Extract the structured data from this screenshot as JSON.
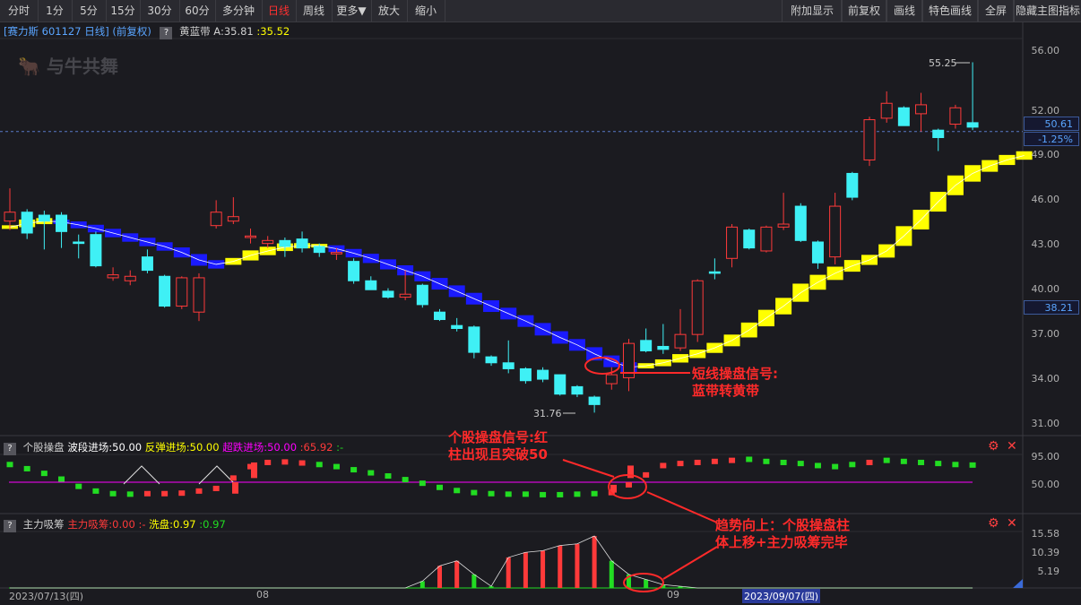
{
  "toolbar": {
    "left": [
      "分时",
      "1分",
      "5分",
      "15分",
      "30分",
      "60分",
      "多分钟",
      "日线",
      "周线",
      "更多▼",
      "放大",
      "缩小"
    ],
    "active": "日线",
    "right": [
      "附加显示",
      "前复权",
      "画线",
      "特色画线",
      "全屏",
      "隐藏主图指标"
    ]
  },
  "main": {
    "stock_label": "[赛力斯 601127 日线] (前复权)",
    "indicator_name": "黄蓝带",
    "indicator_a": "A:35.81",
    "indicator_b": ":35.52",
    "watermark": "与牛共舞",
    "price_now": "50.61",
    "change": "-1.25%",
    "cross_price": "38.21",
    "high_label": "55.25",
    "low_label": "31.76",
    "yticks": [
      "56.00",
      "52.00",
      "49.00",
      "46.00",
      "43.00",
      "40.00",
      "37.00",
      "34.00",
      "31.00"
    ]
  },
  "sub1": {
    "name": "个股操盘",
    "l1": "波段进场:50.00",
    "l2": "反弹进场:50.00",
    "l3": "超跌进场:50.00",
    "l4": ":65.92",
    "l5": ":-",
    "yticks": [
      "95.00",
      "50.00"
    ]
  },
  "sub2": {
    "name": "主力吸筹",
    "l1": "主力吸筹:0.00",
    "l2": ":-",
    "l3": "洗盘:0.97",
    "l4": ":0.97",
    "yticks": [
      "15.58",
      "10.39",
      "5.19"
    ]
  },
  "xaxis": {
    "start": "2023/07/13(四)",
    "aug": "08",
    "sep": "09",
    "cursor_date": "2023/09/07(四)"
  },
  "annotations": {
    "a1_line1": "短线操盘信号:",
    "a1_line2": "蓝带转黄带",
    "a2_line1": "个股操盘信号:红",
    "a2_line2": "柱出现且突破50",
    "a3_line1": "趋势向上：个股操盘柱",
    "a3_line2": "体上移+主力吸筹完毕"
  },
  "colors": {
    "up": "#ff3a3a",
    "down": "#3ff0f5",
    "yellow": "#ffff00",
    "blue": "#1a1aff",
    "green": "#22dd22",
    "magenta": "#ff00ff"
  },
  "candles": [
    [
      44.6,
      45.2,
      44.0,
      46.8
    ],
    [
      45.2,
      43.8,
      43.4,
      45.4
    ],
    [
      45.0,
      44.6,
      42.7,
      45.3
    ],
    [
      45.0,
      43.9,
      42.8,
      45.2
    ],
    [
      43.2,
      43.1,
      42.1,
      43.7
    ],
    [
      43.7,
      41.6,
      41.5,
      43.9
    ],
    [
      40.8,
      41.0,
      40.6,
      41.5
    ],
    [
      40.6,
      40.9,
      40.3,
      41.3
    ],
    [
      42.2,
      41.3,
      41.1,
      42.7
    ],
    [
      40.9,
      38.9,
      38.8,
      41.0
    ],
    [
      38.9,
      40.8,
      38.7,
      40.9
    ],
    [
      38.5,
      40.8,
      37.9,
      41.1
    ],
    [
      44.3,
      45.2,
      44.1,
      46.0
    ],
    [
      44.6,
      44.9,
      44.4,
      46.2
    ],
    [
      43.5,
      43.6,
      43.1,
      44.1
    ],
    [
      43.1,
      43.3,
      42.8,
      43.6
    ],
    [
      43.3,
      42.9,
      42.2,
      43.5
    ],
    [
      43.4,
      42.8,
      42.5,
      43.9
    ],
    [
      42.9,
      42.5,
      42.2,
      43.1
    ],
    [
      42.4,
      42.5,
      42.0,
      42.8
    ],
    [
      41.9,
      40.6,
      40.4,
      42.1
    ],
    [
      40.6,
      40.0,
      40.0,
      40.9
    ],
    [
      39.9,
      39.5,
      39.4,
      40.1
    ],
    [
      39.5,
      39.7,
      39.3,
      41.3
    ],
    [
      40.3,
      39.0,
      38.8,
      40.4
    ],
    [
      38.5,
      38.0,
      37.9,
      38.7
    ],
    [
      37.6,
      37.4,
      37.2,
      38.1
    ],
    [
      37.5,
      35.8,
      35.4,
      37.6
    ],
    [
      35.5,
      35.1,
      34.9,
      35.6
    ],
    [
      35.1,
      34.7,
      34.4,
      36.6
    ],
    [
      34.7,
      33.9,
      33.7,
      34.8
    ],
    [
      34.6,
      34.0,
      33.8,
      34.8
    ],
    [
      34.3,
      33.0,
      32.9,
      34.3
    ],
    [
      33.5,
      33.0,
      32.8,
      33.6
    ],
    [
      32.8,
      32.3,
      31.76,
      32.9
    ],
    [
      33.7,
      34.3,
      33.3,
      34.8
    ],
    [
      34.1,
      36.4,
      33.2,
      36.7
    ],
    [
      36.6,
      35.9,
      35.8,
      37.4
    ],
    [
      36.2,
      36.0,
      35.7,
      37.7
    ],
    [
      36.1,
      37.0,
      35.9,
      38.7
    ],
    [
      37.0,
      40.6,
      36.5,
      40.7
    ],
    [
      41.2,
      41.1,
      40.7,
      42.1
    ],
    [
      42.1,
      44.2,
      41.5,
      44.4
    ],
    [
      44.0,
      42.8,
      42.7,
      44.1
    ],
    [
      42.6,
      44.2,
      42.5,
      44.3
    ],
    [
      44.2,
      44.4,
      44.0,
      46.5
    ],
    [
      45.6,
      43.3,
      43.2,
      45.8
    ],
    [
      43.2,
      41.8,
      41.4,
      43.3
    ],
    [
      42.2,
      45.6,
      41.7,
      46.5
    ],
    [
      47.8,
      46.2,
      46.0,
      47.9
    ],
    [
      48.7,
      51.4,
      48.3,
      51.6
    ],
    [
      51.5,
      52.5,
      51.2,
      53.3
    ],
    [
      52.2,
      51.0,
      51.0,
      52.3
    ],
    [
      51.8,
      52.4,
      50.6,
      53.2
    ],
    [
      50.7,
      50.2,
      49.3,
      50.8
    ],
    [
      51.1,
      52.2,
      50.8,
      52.4
    ],
    [
      51.2,
      50.9,
      50.7,
      55.25
    ]
  ],
  "bands": [
    [
      44.2,
      1
    ],
    [
      44.45,
      1
    ],
    [
      44.6,
      1
    ],
    [
      44.55,
      0
    ],
    [
      44.35,
      0
    ],
    [
      44.1,
      0
    ],
    [
      43.8,
      0
    ],
    [
      43.5,
      0
    ],
    [
      43.2,
      0
    ],
    [
      42.9,
      0
    ],
    [
      42.5,
      0
    ],
    [
      42.0,
      0
    ],
    [
      41.7,
      0
    ],
    [
      41.9,
      1
    ],
    [
      42.3,
      1
    ],
    [
      42.6,
      1
    ],
    [
      42.85,
      1
    ],
    [
      42.95,
      1
    ],
    [
      42.95,
      1
    ],
    [
      42.75,
      0
    ],
    [
      42.45,
      0
    ],
    [
      42.1,
      0
    ],
    [
      41.7,
      0
    ],
    [
      41.3,
      0
    ],
    [
      40.9,
      0
    ],
    [
      40.4,
      0
    ],
    [
      39.9,
      0
    ],
    [
      39.4,
      0
    ],
    [
      38.9,
      0
    ],
    [
      38.4,
      0
    ],
    [
      37.9,
      0
    ],
    [
      37.35,
      0
    ],
    [
      36.8,
      0
    ],
    [
      36.3,
      0
    ],
    [
      35.7,
      0
    ],
    [
      35.2,
      0
    ],
    [
      34.8,
      0
    ],
    [
      34.9,
      1
    ],
    [
      35.1,
      1
    ],
    [
      35.4,
      1
    ],
    [
      35.7,
      1
    ],
    [
      36.1,
      1
    ],
    [
      36.6,
      1
    ],
    [
      37.3,
      1
    ],
    [
      38.1,
      1
    ],
    [
      38.9,
      1
    ],
    [
      39.8,
      1
    ],
    [
      40.5,
      1
    ],
    [
      41.1,
      1
    ],
    [
      41.6,
      1
    ],
    [
      42.0,
      1
    ],
    [
      42.6,
      1
    ],
    [
      43.6,
      1
    ],
    [
      44.7,
      1
    ],
    [
      45.9,
      1
    ],
    [
      47.0,
      1
    ],
    [
      47.8,
      1
    ],
    [
      48.3,
      1
    ],
    [
      48.7,
      1
    ],
    [
      49.0,
      1
    ]
  ],
  "sub1_vals": [
    [
      84,
      1
    ],
    [
      76,
      1
    ],
    [
      67,
      1
    ],
    [
      56,
      1
    ],
    [
      42,
      1
    ],
    [
      33,
      1
    ],
    [
      28,
      1
    ],
    [
      27,
      1
    ],
    [
      28,
      0
    ],
    [
      28,
      0
    ],
    [
      29,
      0
    ],
    [
      33,
      0
    ],
    [
      38,
      0
    ],
    [
      58,
      0
    ],
    [
      80,
      0
    ],
    [
      88,
      0
    ],
    [
      89,
      0
    ],
    [
      87,
      0
    ],
    [
      84,
      1
    ],
    [
      80,
      1
    ],
    [
      74,
      1
    ],
    [
      68,
      1
    ],
    [
      62,
      1
    ],
    [
      55,
      1
    ],
    [
      48,
      1
    ],
    [
      40,
      1
    ],
    [
      34,
      1
    ],
    [
      30,
      1
    ],
    [
      28,
      1
    ],
    [
      27,
      1
    ],
    [
      27,
      1
    ],
    [
      26,
      1
    ],
    [
      26,
      1
    ],
    [
      27,
      1
    ],
    [
      28,
      1
    ],
    [
      30,
      0
    ],
    [
      45,
      0
    ],
    [
      64,
      0
    ],
    [
      82,
      0
    ],
    [
      86,
      0
    ],
    [
      88,
      0
    ],
    [
      90,
      0
    ],
    [
      92,
      0
    ],
    [
      94,
      1
    ],
    [
      90,
      1
    ],
    [
      88,
      1
    ],
    [
      86,
      1
    ],
    [
      82,
      1
    ],
    [
      80,
      1
    ],
    [
      84,
      1
    ],
    [
      88,
      0
    ],
    [
      92,
      1
    ],
    [
      90,
      1
    ],
    [
      88,
      1
    ],
    [
      86,
      1
    ],
    [
      84,
      1
    ],
    [
      83,
      1
    ]
  ],
  "sub2_vals": [
    0,
    0,
    0,
    0,
    0,
    0,
    0,
    0,
    0,
    0,
    0,
    0,
    0,
    0,
    0,
    0,
    0,
    0,
    0,
    0,
    0,
    0,
    0,
    0,
    2,
    6.5,
    8,
    4,
    0.5,
    9,
    10.5,
    11,
    12.5,
    13,
    15.3,
    8,
    4,
    2.5,
    1,
    0.5,
    0,
    0,
    0,
    0,
    0,
    0,
    0,
    0,
    0,
    0,
    0,
    0,
    0,
    0,
    0,
    0,
    0
  ]
}
